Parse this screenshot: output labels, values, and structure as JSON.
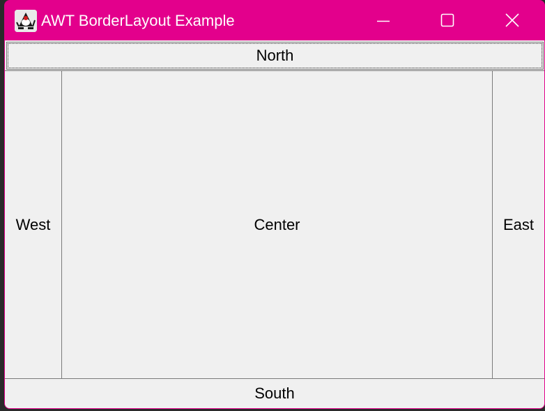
{
  "window": {
    "title": "AWT BorderLayout Example",
    "accent_color": "#e3008c",
    "icon": "java-duke-icon",
    "controls": [
      "minimize-icon",
      "maximize-icon",
      "close-icon"
    ]
  },
  "layout": {
    "north": "North",
    "west": "West",
    "center": "Center",
    "east": "East",
    "south": "South"
  }
}
